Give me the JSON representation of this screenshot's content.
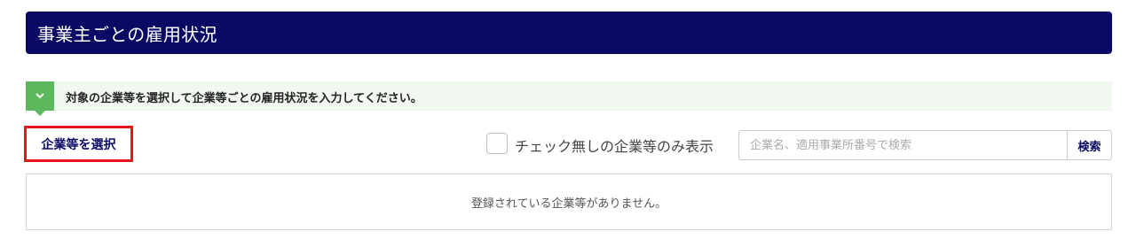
{
  "header": {
    "title": "事業主ごとの雇用状況"
  },
  "info": {
    "message": "対象の企業等を選択して企業等ごとの雇用状況を入力してください。",
    "icon": "chevron-down-icon",
    "accent_color": "#5cb85c"
  },
  "toolbar": {
    "select_label": "企業等を選択",
    "filter_unchecked_label": "チェック無しの企業等のみ表示",
    "filter_checked": false,
    "search_placeholder": "企業名、適用事業所番号で検索",
    "search_value": "",
    "search_button_label": "検索"
  },
  "results": {
    "empty_message": "登録されている企業等がありません。"
  },
  "colors": {
    "header_bg": "#0a0a64",
    "highlight_border": "#e8141c"
  }
}
